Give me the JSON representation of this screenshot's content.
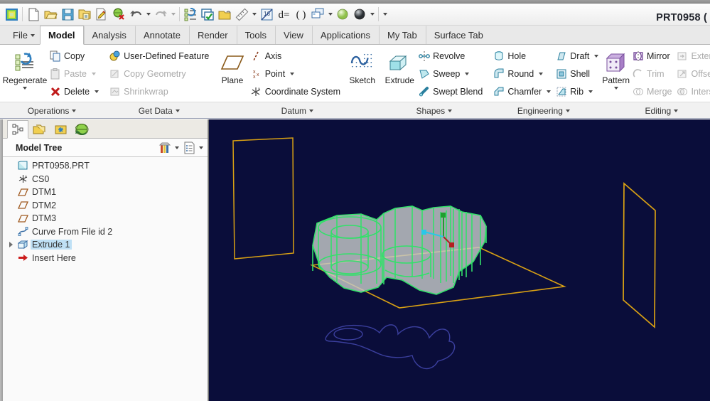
{
  "window": {
    "app_title": "PRT0958 ("
  },
  "quick_access": {
    "items": [
      {
        "name": "creo-logo-icon",
        "label": "Creo Parametric"
      },
      {
        "name": "new-icon",
        "label": "New"
      },
      {
        "name": "open-icon",
        "label": "Open"
      },
      {
        "name": "save-icon",
        "label": "Save"
      },
      {
        "name": "save-a-copy-icon",
        "label": "Save A Copy"
      },
      {
        "name": "edit-file-icon",
        "label": "Edit File"
      },
      {
        "name": "close-window-icon",
        "label": "Close"
      },
      {
        "name": "undo-icon",
        "label": "Undo"
      },
      {
        "name": "undo-dropdown-caret",
        "label": "Undo options"
      },
      {
        "name": "redo-icon",
        "label": "Redo"
      },
      {
        "name": "redo-dropdown-caret",
        "label": "Redo options"
      },
      {
        "name": "regenerate-icon",
        "label": "Regenerate"
      },
      {
        "name": "select-items-icon",
        "label": "Select Items"
      },
      {
        "name": "open-folder-icon",
        "label": "Folder Browser"
      },
      {
        "name": "measure-icon",
        "label": "Measure"
      },
      {
        "name": "measure-dropdown-caret",
        "label": "Measure options"
      },
      {
        "name": "annotate-icon",
        "label": "Annotation Display"
      },
      {
        "name": "dimension-icon",
        "label": "Dimension Display"
      },
      {
        "name": "parameters-icon",
        "label": "Parameters"
      },
      {
        "name": "layers-icon",
        "label": "Layers"
      },
      {
        "name": "layers-dropdown-caret",
        "label": "Layer options"
      },
      {
        "name": "appearance-light-icon",
        "label": "Appearance Gallery"
      },
      {
        "name": "appearance-dark-icon",
        "label": "Shading"
      },
      {
        "name": "appearance-dropdown-caret",
        "label": "Shading options"
      },
      {
        "name": "customize-qat-caret",
        "label": "Customize Quick Access Toolbar"
      }
    ]
  },
  "ribbon": {
    "tabs": [
      {
        "label": "File",
        "active": false,
        "has_caret": true
      },
      {
        "label": "Model",
        "active": true,
        "has_caret": false
      },
      {
        "label": "Analysis",
        "active": false,
        "has_caret": false
      },
      {
        "label": "Annotate",
        "active": false,
        "has_caret": false
      },
      {
        "label": "Render",
        "active": false,
        "has_caret": false
      },
      {
        "label": "Tools",
        "active": false,
        "has_caret": false
      },
      {
        "label": "View",
        "active": false,
        "has_caret": false
      },
      {
        "label": "Applications",
        "active": false,
        "has_caret": false
      },
      {
        "label": "My Tab",
        "active": false,
        "has_caret": false
      },
      {
        "label": "Surface Tab",
        "active": false,
        "has_caret": false
      }
    ],
    "groups": [
      {
        "name": "operations",
        "label": "Operations",
        "big": [
          {
            "label": "Regenerate",
            "icon": "regenerate-icon",
            "caret": true
          }
        ],
        "items": [
          {
            "label": "Copy",
            "icon": "copy-icon",
            "caret": false,
            "disabled": false
          },
          {
            "label": "Paste",
            "icon": "paste-icon",
            "caret": true,
            "disabled": true
          },
          {
            "label": "Delete",
            "icon": "delete-icon",
            "caret": true,
            "disabled": false
          }
        ]
      },
      {
        "name": "get-data",
        "label": "Get Data",
        "big": [],
        "items": [
          {
            "label": "User-Defined Feature",
            "icon": "udf-icon",
            "caret": false,
            "disabled": false
          },
          {
            "label": "Copy Geometry",
            "icon": "copy-geometry-icon",
            "caret": false,
            "disabled": true
          },
          {
            "label": "Shrinkwrap",
            "icon": "shrinkwrap-icon",
            "caret": false,
            "disabled": true
          }
        ]
      },
      {
        "name": "datum",
        "label": "Datum",
        "big": [
          {
            "label": "Plane",
            "icon": "plane-icon",
            "caret": false
          }
        ],
        "items": [
          {
            "label": "Axis",
            "icon": "axis-icon",
            "caret": false,
            "disabled": false
          },
          {
            "label": "Point",
            "icon": "point-icon",
            "caret": true,
            "disabled": false
          },
          {
            "label": "Coordinate System",
            "icon": "coordinate-system-icon",
            "caret": false,
            "disabled": false
          }
        ],
        "big2": [
          {
            "label": "Sketch",
            "icon": "sketch-icon",
            "caret": false
          }
        ]
      },
      {
        "name": "shapes",
        "label": "Shapes",
        "big": [
          {
            "label": "Extrude",
            "icon": "extrude-icon",
            "caret": false
          }
        ],
        "items": [
          {
            "label": "Revolve",
            "icon": "revolve-icon",
            "caret": false,
            "disabled": false
          },
          {
            "label": "Sweep",
            "icon": "sweep-icon",
            "caret": true,
            "disabled": false
          },
          {
            "label": "Swept Blend",
            "icon": "swept-blend-icon",
            "caret": false,
            "disabled": false
          }
        ]
      },
      {
        "name": "engineering",
        "label": "Engineering",
        "big": [],
        "items": [
          {
            "label": "Hole",
            "icon": "hole-icon",
            "caret": false,
            "disabled": false
          },
          {
            "label": "Round",
            "icon": "round-icon",
            "caret": true,
            "disabled": false
          },
          {
            "label": "Chamfer",
            "icon": "chamfer-icon",
            "caret": true,
            "disabled": false
          }
        ],
        "items2": [
          {
            "label": "Draft",
            "icon": "draft-icon",
            "caret": true,
            "disabled": false
          },
          {
            "label": "Shell",
            "icon": "shell-icon",
            "caret": false,
            "disabled": false
          },
          {
            "label": "Rib",
            "icon": "rib-icon",
            "caret": true,
            "disabled": false
          }
        ]
      },
      {
        "name": "editing",
        "label": "Editing",
        "big": [
          {
            "label": "Pattern",
            "icon": "pattern-icon",
            "caret": true
          }
        ],
        "items": [
          {
            "label": "Mirror",
            "icon": "mirror-icon",
            "caret": false,
            "disabled": false
          },
          {
            "label": "Trim",
            "icon": "trim-icon",
            "caret": false,
            "disabled": true
          },
          {
            "label": "Merge",
            "icon": "merge-icon",
            "caret": false,
            "disabled": true
          }
        ],
        "items2": [
          {
            "label": "Extend",
            "icon": "extend-icon",
            "caret": false,
            "disabled": true
          },
          {
            "label": "Offset",
            "icon": "offset-icon",
            "caret": false,
            "disabled": true
          },
          {
            "label": "Intersect",
            "icon": "intersect-icon",
            "caret": false,
            "disabled": true
          }
        ]
      }
    ]
  },
  "navigator": {
    "tabs": [
      {
        "name": "model-tree-tab",
        "label": "Model Tree",
        "active": true
      },
      {
        "name": "folder-browser-tab",
        "label": "Folder Browser",
        "active": false
      },
      {
        "name": "favorites-tab",
        "label": "Favorites",
        "active": false
      },
      {
        "name": "connections-tab",
        "label": "Connections",
        "active": false
      }
    ],
    "tree_title": "Model Tree",
    "tree_tools": [
      {
        "name": "tree-filters-icon",
        "label": "Filters"
      },
      {
        "name": "tree-filters-caret",
        "label": "Filter options"
      },
      {
        "name": "tree-settings-icon",
        "label": "Settings"
      },
      {
        "name": "tree-settings-caret",
        "label": "Settings options"
      }
    ],
    "tree_items": [
      {
        "label": "PRT0958.PRT",
        "icon": "part-icon",
        "indent": 0,
        "expander": false,
        "selected": false
      },
      {
        "label": "CS0",
        "icon": "coordinate-system-icon",
        "indent": 1,
        "expander": false,
        "selected": false
      },
      {
        "label": "DTM1",
        "icon": "datum-plane-icon",
        "indent": 1,
        "expander": false,
        "selected": false
      },
      {
        "label": "DTM2",
        "icon": "datum-plane-icon",
        "indent": 1,
        "expander": false,
        "selected": false
      },
      {
        "label": "DTM3",
        "icon": "datum-plane-icon",
        "indent": 1,
        "expander": false,
        "selected": false
      },
      {
        "label": "Curve From File id 2",
        "icon": "curve-icon",
        "indent": 1,
        "expander": false,
        "selected": false
      },
      {
        "label": "Extrude 1",
        "icon": "extrude-feature-icon",
        "indent": 1,
        "expander": true,
        "selected": true
      },
      {
        "label": "Insert Here",
        "icon": "insert-here-icon",
        "indent": 1,
        "expander": false,
        "selected": false
      }
    ]
  },
  "viewport": {
    "background_color": "#0a0d3a",
    "datum_plane_color": "#d8a014",
    "solid_edge_color": "#33e06a",
    "solid_face_color": "#c6c9c9",
    "curve_color": "#3b3f9e",
    "entities": [
      {
        "name": "datum-plane-dtm1",
        "type": "datum-plane"
      },
      {
        "name": "datum-plane-dtm2",
        "type": "datum-plane"
      },
      {
        "name": "datum-plane-dtm3",
        "type": "datum-plane"
      },
      {
        "name": "curve-from-file",
        "type": "curve"
      },
      {
        "name": "extrude-1-solid",
        "type": "solid"
      },
      {
        "name": "coordinate-system-cs0",
        "type": "csys"
      }
    ],
    "csys_axes": [
      {
        "name": "x-axis",
        "color": "#29c7e8"
      },
      {
        "name": "y-axis",
        "color": "#b32020"
      },
      {
        "name": "z-axis",
        "color": "#1f9f2f"
      }
    ]
  }
}
